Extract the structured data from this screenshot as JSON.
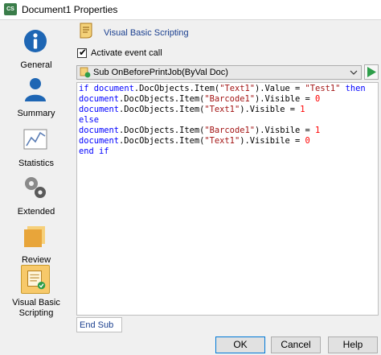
{
  "window": {
    "title": "Document1 Properties",
    "app_icon_text": "CS"
  },
  "sidebar": {
    "items": [
      {
        "label": "General",
        "icon": "info-icon",
        "active": false
      },
      {
        "label": "Summary",
        "icon": "person-icon",
        "active": false
      },
      {
        "label": "Statistics",
        "icon": "chart-icon",
        "active": false
      },
      {
        "label": "Extended",
        "icon": "gears-icon",
        "active": false
      },
      {
        "label": "Review",
        "icon": "folder-icon",
        "active": false
      },
      {
        "label": "Visual Basic Scripting",
        "icon": "script-icon",
        "active": true
      }
    ]
  },
  "panel": {
    "title": "Visual Basic Scripting",
    "activate_label": "Activate event call",
    "activate_checked": true,
    "event_dropdown": {
      "selected": "Sub OnBeforePrintJob(ByVal Doc)"
    },
    "code_lines": [
      "if document.DocObjects.Item(\"Text1\").Value = \"Test1\" then",
      "document.DocObjects.Item(\"Barcode1\").Visible = 0",
      "document.DocObjects.Item(\"Text1\").Visible = 1",
      "else",
      "document.DocObjects.Item(\"Barcode1\").Visbile = 1",
      "document.DocObjects.Item(\"Text1\").Visibile = 0",
      "end if"
    ],
    "end_label": "End Sub"
  },
  "buttons": {
    "ok": "OK",
    "cancel": "Cancel",
    "help": "Help"
  },
  "colors": {
    "accent": "#1a3f8f",
    "active_item": "#f7c96a",
    "keyword": "#0000ff",
    "string": "#a31515",
    "number": "#ff0000"
  }
}
